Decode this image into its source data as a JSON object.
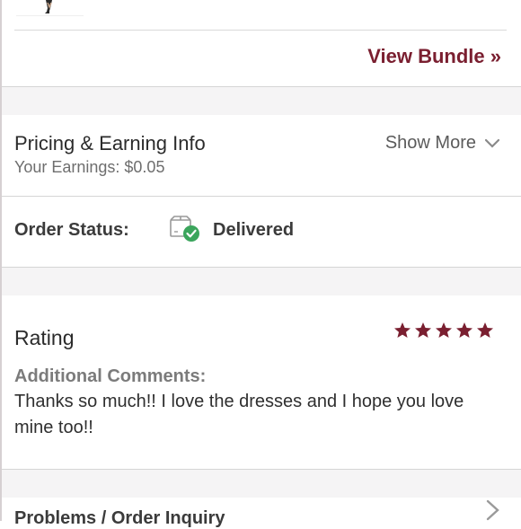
{
  "bundle": {
    "view_bundle_label": "View Bundle »"
  },
  "pricing": {
    "title": "Pricing & Earning Info",
    "earnings": "Your Earnings: $0.05",
    "show_more_label": "Show More"
  },
  "order": {
    "status_label": "Order Status:",
    "status_value": "Delivered"
  },
  "rating": {
    "title": "Rating",
    "stars": 5,
    "comments_label": "Additional Comments:",
    "comment_text": "Thanks so much!! I love the dresses and I hope you love mine too!!"
  },
  "problems": {
    "label": "Problems / Order Inquiry"
  },
  "colors": {
    "brand": "#7a1f30",
    "success": "#3ba55c"
  },
  "icons": {
    "show_more": "chevron-down-icon",
    "order": "delivered-box-icon",
    "star": "star-icon",
    "problems": "chevron-right-icon"
  }
}
